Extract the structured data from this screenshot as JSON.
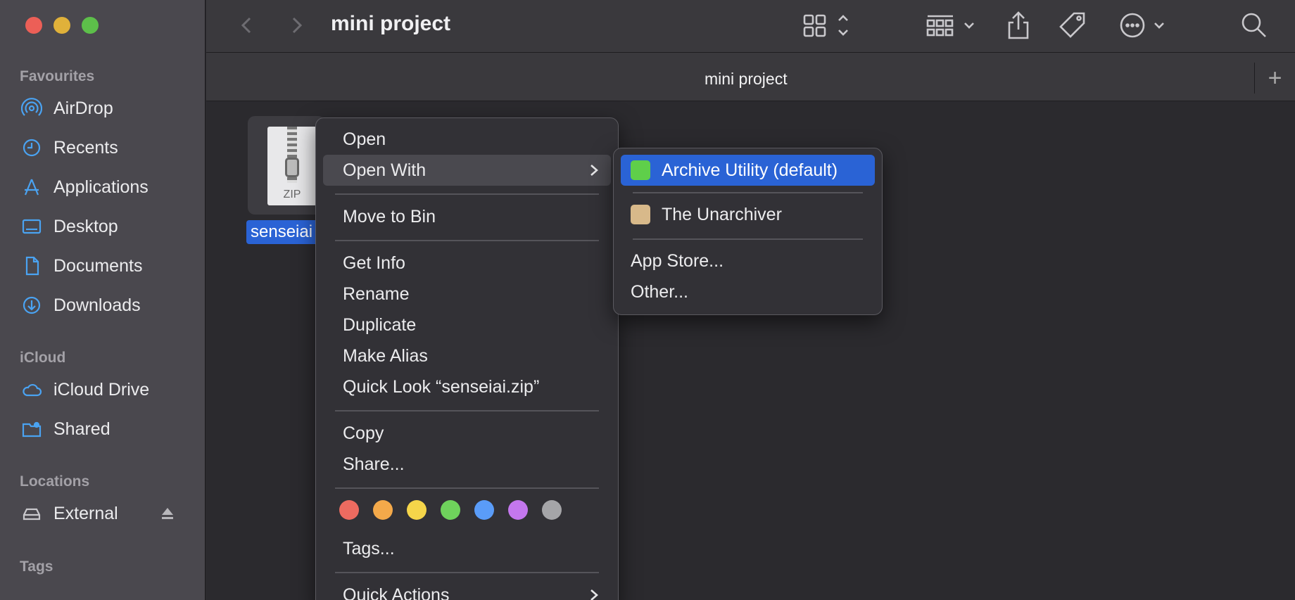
{
  "window": {
    "title": "mini project"
  },
  "sidebar": {
    "sections": [
      {
        "title": "Favourites",
        "items": [
          {
            "label": "AirDrop",
            "icon": "airdrop-icon"
          },
          {
            "label": "Recents",
            "icon": "clock-icon"
          },
          {
            "label": "Applications",
            "icon": "applications-icon"
          },
          {
            "label": "Desktop",
            "icon": "desktop-icon"
          },
          {
            "label": "Documents",
            "icon": "document-icon"
          },
          {
            "label": "Downloads",
            "icon": "download-icon"
          }
        ]
      },
      {
        "title": "iCloud",
        "items": [
          {
            "label": "iCloud Drive",
            "icon": "cloud-icon"
          },
          {
            "label": "Shared",
            "icon": "shared-folder-icon"
          }
        ]
      },
      {
        "title": "Locations",
        "items": [
          {
            "label": "External",
            "icon": "drive-icon"
          }
        ]
      },
      {
        "title": "Tags",
        "items": []
      }
    ]
  },
  "tabbar": {
    "tab_label": "mini project",
    "add_tab": "+"
  },
  "file": {
    "name": "senseiai",
    "badge": "ZIP"
  },
  "context_menu": {
    "items": [
      {
        "label": "Open"
      },
      {
        "label": "Open With",
        "submenu": true
      },
      {
        "label": "Move to Bin"
      },
      {
        "label": "Get Info"
      },
      {
        "label": "Rename"
      },
      {
        "label": "Duplicate"
      },
      {
        "label": "Make Alias"
      },
      {
        "label": "Quick Look “senseiai.zip”"
      },
      {
        "label": "Copy"
      },
      {
        "label": "Share..."
      },
      {
        "label": "Tags..."
      },
      {
        "label": "Quick Actions",
        "submenu": true
      }
    ],
    "tag_colors": [
      "#ed6b60",
      "#f4a94a",
      "#f5d54a",
      "#6fd25c",
      "#5a9cf8",
      "#c477ee",
      "#a5a5a8"
    ]
  },
  "open_with_submenu": {
    "items": [
      {
        "label": "Archive Utility (default)",
        "icon": "archive-utility-icon",
        "color": "#5fcf4a"
      },
      {
        "label": "The Unarchiver",
        "icon": "unarchiver-icon",
        "color": "#d8b98a"
      },
      {
        "label": "App Store..."
      },
      {
        "label": "Other..."
      }
    ]
  }
}
